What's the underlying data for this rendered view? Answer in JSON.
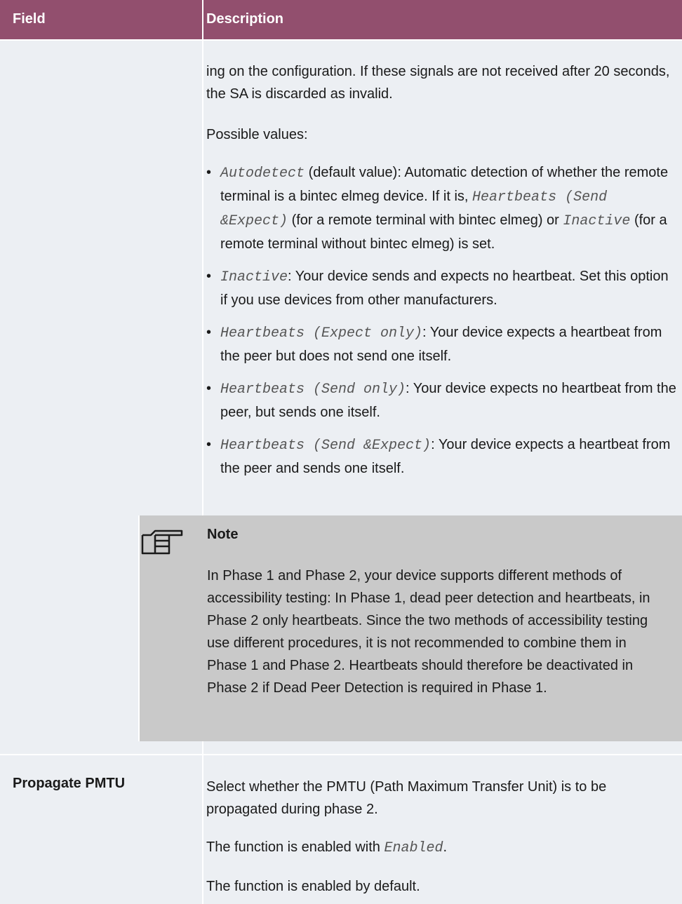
{
  "header": {
    "field": "Field",
    "description": "Description"
  },
  "continuation": {
    "intro": "ing on the configuration. If these signals are not received after 20 seconds, the SA is discarded as invalid.",
    "possible_values": "Possible values:",
    "bullets": [
      {
        "code": "Autodetect",
        "parts": [
          " (default value): Automatic detection of whether the remote terminal is a bintec elmeg device. If it is, ",
          "Heart­beats (Send &Expect)",
          " (for a remote terminal with bintec elmeg) or ",
          "Inactive",
          " (for a remote terminal without bintec el­meg) is set."
        ]
      },
      {
        "code": "Inactive",
        "text": ": Your device sends and expects no heartbeat. Set this option if you use devices from other manufacturers."
      },
      {
        "code": "Heartbeats (Expect only)",
        "text": ": Your device expects a heartbeat from the peer but does not send one itself."
      },
      {
        "code": "Heartbeats (Send only)",
        "text": ": Your device expects no heart­beat from the peer, but sends one itself."
      },
      {
        "code": "Heartbeats (Send &Expect)",
        "text": ": Your device expects a heartbeat from the peer and sends one itself."
      }
    ]
  },
  "note": {
    "icon": "pointing-hand-icon",
    "title": "Note",
    "body": "In Phase 1 and Phase 2, your device supports different methods of accessibility testing: In Phase 1, dead peer de­tection and heartbeats, in Phase 2 only heartbeats. Since the two methods of accessibility testing use different pro­cedures, it is not recommended to combine them in Phase 1 and Phase 2. Heartbeats should therefore be deactivated in Phase 2 if Dead Peer Detection is required in Phase 1."
  },
  "propagate_pmtu": {
    "field": "Propagate PMTU",
    "desc1": "Select whether the PMTU (Path Maximum Transfer Unit) is to be propagated during phase 2.",
    "desc2_pre": "The function is enabled with ",
    "desc2_code": "Enabled",
    "desc2_post": ".",
    "desc3": "The function is enabled by default."
  },
  "colors": {
    "header_bg": "#924f6e",
    "cell_bg": "#eceff3",
    "note_bg": "#c9c9c9"
  }
}
